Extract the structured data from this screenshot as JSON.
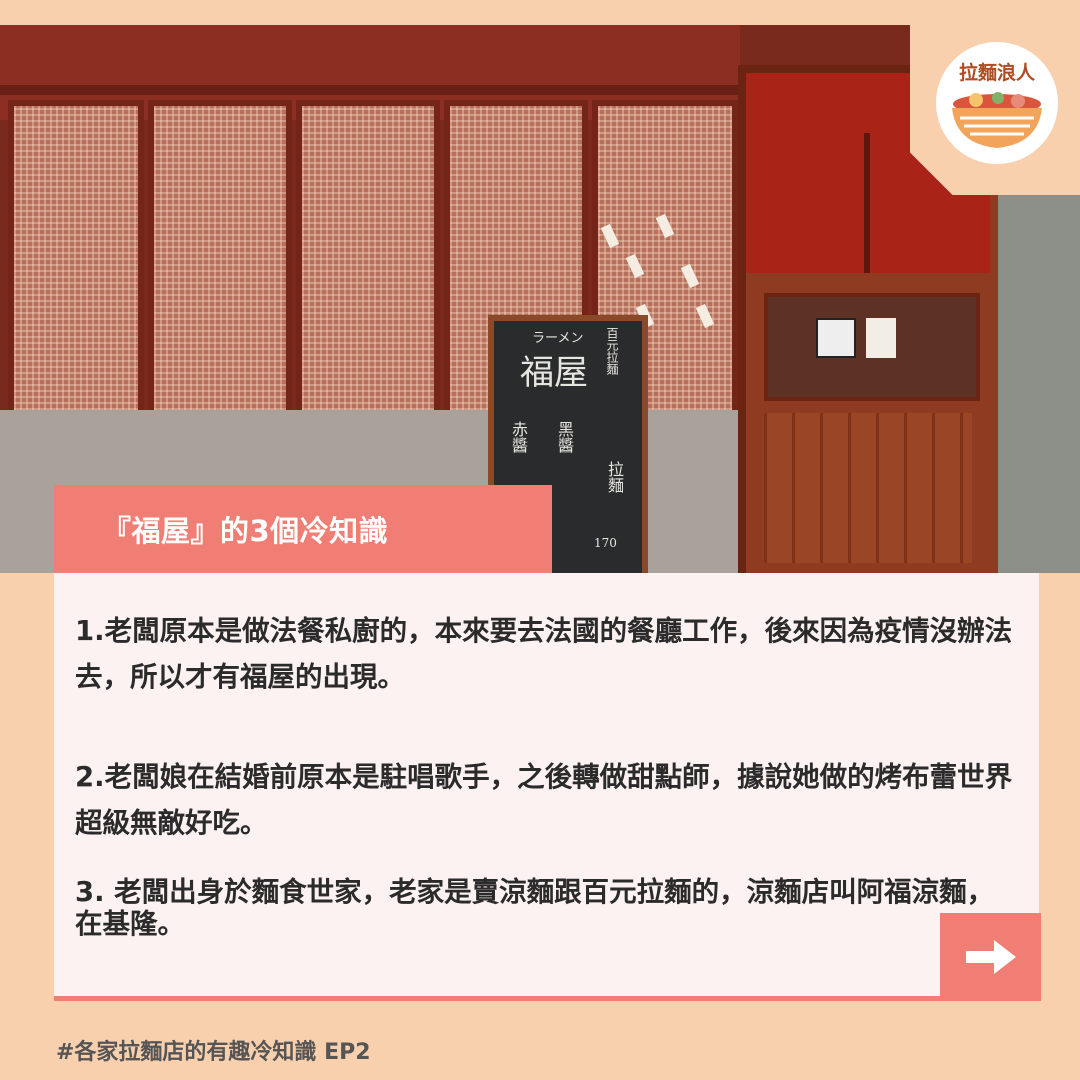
{
  "logo": {
    "text": "拉麵浪人",
    "icon": "ramen-bowl-icon"
  },
  "photo": {
    "alt_icon": "storefront-photo",
    "blackboard_text": {
      "line_top": "ラーメン",
      "shop_name": "福屋",
      "right_header": "百元拉麵",
      "menu_left": "赤醬",
      "menu_mid": "黑醬",
      "menu_right": "拉麵",
      "price": "170"
    }
  },
  "title": {
    "text": "『福屋』的3個冷知識"
  },
  "facts": [
    {
      "text": "1.老闆原本是做法餐私廚的，本來要去法國的餐廳工作，後來因為疫情沒辦法去，所以才有福屋的出現。"
    },
    {
      "text": "2.老闆娘在結婚前原本是駐唱歌手，之後轉做甜點師，據說她做的烤布蕾世界超級無敵好吃。"
    },
    {
      "text": "3. 老闆出身於麵食世家，老家是賣涼麵跟百元拉麵的，涼麵店叫阿福涼麵，在基隆。"
    }
  ],
  "next_button": {
    "icon": "arrow-right-icon"
  },
  "footer": {
    "hashtag": "#各家拉麵店的有趣冷知識  EP2"
  },
  "colors": {
    "background": "#f9d0ae",
    "accent": "#f07e74",
    "card": "#fdf2f2",
    "logo_text": "#b04b22"
  }
}
